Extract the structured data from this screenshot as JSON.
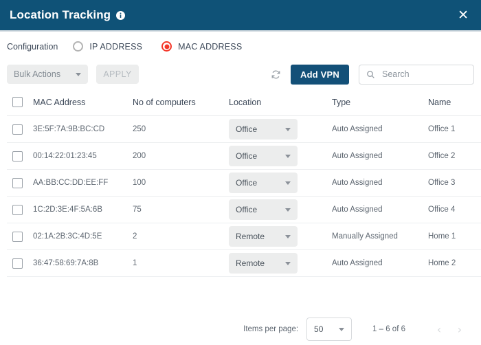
{
  "window": {
    "title": "Location Tracking",
    "info_icon": "info-circle-icon",
    "close_icon": "close-icon",
    "header_color": "#0f5277"
  },
  "configuration": {
    "label": "Configuration",
    "options": [
      {
        "label": "IP ADDRESS",
        "selected": false
      },
      {
        "label": "MAC ADDRESS",
        "selected": true
      }
    ],
    "accent_color": "#f4382a"
  },
  "toolbar": {
    "bulk_actions_label": "Bulk Actions",
    "bulk_actions_disabled": true,
    "apply_label": "APPLY",
    "apply_disabled": true,
    "refresh_icon": "refresh-icon",
    "add_vpn_label": "Add VPN",
    "add_vpn_color": "#135078",
    "search": {
      "icon": "search-icon",
      "value": "",
      "placeholder": "Search"
    }
  },
  "table": {
    "columns": [
      "MAC Address",
      "No of computers",
      "Location",
      "Type",
      "Name"
    ],
    "select_all_checked": false,
    "rows": [
      {
        "checked": false,
        "mac": "3E:5F:7A:9B:BC:CD",
        "computers": "250",
        "location": "Office",
        "type": "Auto Assigned",
        "name": "Office 1"
      },
      {
        "checked": false,
        "mac": "00:14:22:01:23:45",
        "computers": "200",
        "location": "Office",
        "type": "Auto Assigned",
        "name": "Office 2"
      },
      {
        "checked": false,
        "mac": "AA:BB:CC:DD:EE:FF",
        "computers": "100",
        "location": "Office",
        "type": "Auto Assigned",
        "name": "Office 3"
      },
      {
        "checked": false,
        "mac": "1C:2D:3E:4F:5A:6B",
        "computers": "75",
        "location": "Office",
        "type": "Auto Assigned",
        "name": "Office 4"
      },
      {
        "checked": false,
        "mac": "02:1A:2B:3C:4D:5E",
        "computers": "2",
        "location": "Remote",
        "type": "Manually Assigned",
        "name": "Home 1"
      },
      {
        "checked": false,
        "mac": "36:47:58:69:7A:8B",
        "computers": "1",
        "location": "Remote",
        "type": "Auto Assigned",
        "name": "Home 2"
      }
    ]
  },
  "paginator": {
    "items_per_page_label": "Items per page:",
    "items_per_page_value": "50",
    "range_label": "1 – 6 of 6",
    "prev_icon": "chevron-left-icon",
    "next_icon": "chevron-right-icon",
    "prev_disabled": true,
    "next_disabled": true
  }
}
